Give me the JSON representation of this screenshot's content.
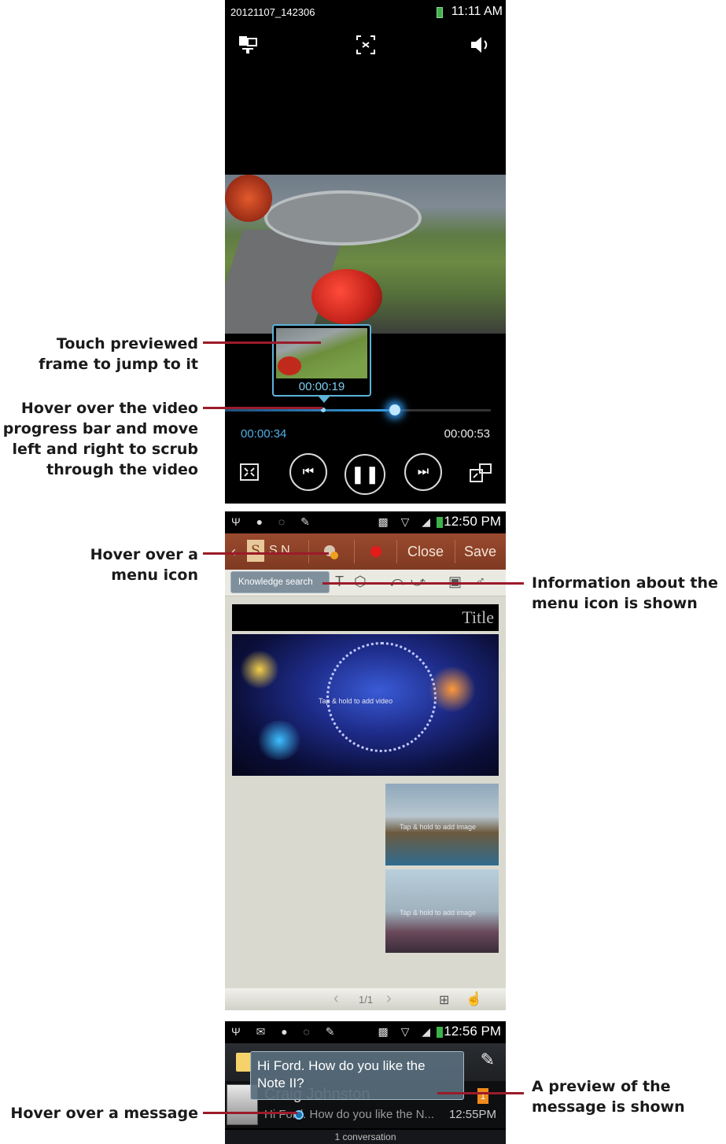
{
  "callouts": {
    "touch_preview": [
      "Touch previewed",
      "frame to jump to it"
    ],
    "hover_progress": [
      "Hover over the video",
      "progress bar and move",
      "left and right to scrub",
      "through the video"
    ],
    "hover_menu_icon": [
      "Hover over a",
      "menu icon"
    ],
    "menu_info": [
      "Information about the",
      "menu icon is shown"
    ],
    "message_preview": [
      "A preview of the",
      "message is shown"
    ],
    "hover_message": [
      "Hover over a message"
    ]
  },
  "colors": {
    "leader": "#9b1b2a",
    "progress": "#3a9fe0",
    "snote_toolbar": "#8a4028"
  },
  "video_player": {
    "filename": "20121107_142306",
    "clock": "11:11 AM",
    "icons": [
      "screen-mirror-icon",
      "capture-icon",
      "volume-icon"
    ],
    "preview_time": "00:00:19",
    "elapsed": "00:00:34",
    "duration": "00:00:53",
    "progress": 0.64,
    "hover_position": 0.36,
    "controls": [
      "fit-screen-icon",
      "previous-icon",
      "pause-icon",
      "next-icon",
      "popup-player-icon"
    ]
  },
  "snote": {
    "clock": "12:50 PM",
    "app_name": "S N",
    "close_label": "Close",
    "save_label": "Save",
    "tooltip": "Knowledge search",
    "title_placeholder": "Title",
    "video_slot_text": "Tap & hold to add video",
    "image_slot_text": "Tap & hold to add image",
    "page_indicator": "1/1"
  },
  "messages": {
    "clock": "12:56 PM",
    "preview_text": "Hi Ford. How do you like the Note II?",
    "contact_name": "Craig Johnston",
    "snippet": "Hi Ford. How do you like the N...",
    "time": "12:55PM",
    "unread_count": "1",
    "footer": "1 conversation"
  }
}
